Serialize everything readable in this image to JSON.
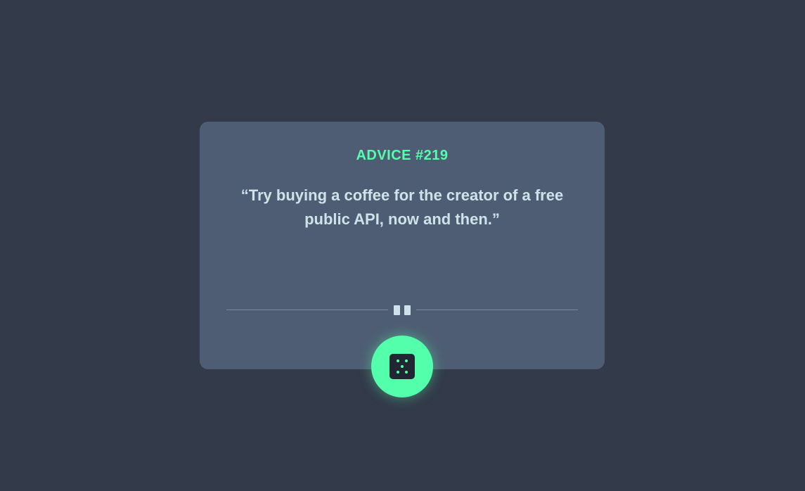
{
  "card": {
    "advice_label": "ADVICE #219",
    "quote": "“Try buying a coffee for the creator of a free public API, now and then.”"
  },
  "divider": {
    "icon": "pause-icon"
  },
  "button": {
    "icon": "dice-icon",
    "color": "#53ffaa"
  },
  "colors": {
    "background": "#333a49",
    "card": "#4e5d73",
    "accent": "#53ffaa",
    "text": "#cee3e9"
  }
}
